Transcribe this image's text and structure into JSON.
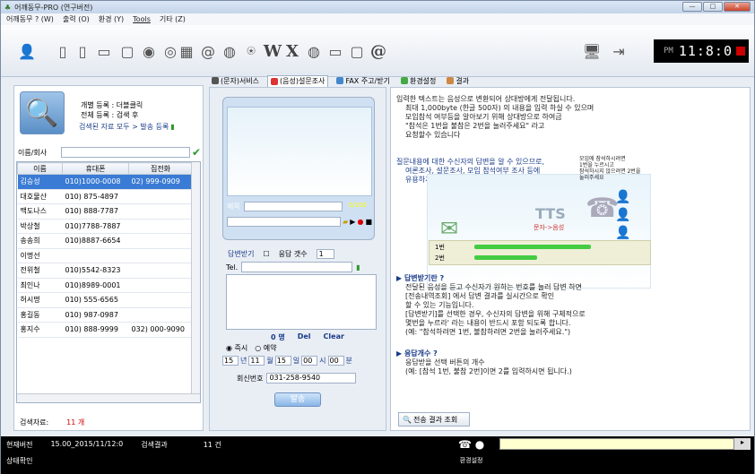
{
  "window": {
    "title": "어깨동무-PRO (연구버전)",
    "min": "—",
    "max": "□",
    "close": "✕"
  },
  "menu": [
    "어깨동무 ? (W)",
    "출력 (O)",
    "환경 (Y)",
    "Tools",
    "기타 (Z)"
  ],
  "toolbar": {
    "text_buttons": [
      "W",
      "X",
      "@"
    ],
    "clock_pm": "PM",
    "clock_time": "11:8:0"
  },
  "tabs": [
    "(문자)서비스",
    "(음성)설문조사",
    "FAX 주고/받기",
    "환경설정",
    "결과"
  ],
  "left": {
    "reg_personal": "개별 등록 : 더블클릭",
    "reg_all": "전체 등록 : 검색 후",
    "reg_link": "검색된 자료 모두 > 발송 등록",
    "search_label": "이름/회사",
    "columns": [
      "이름",
      "휴대폰",
      "집전화"
    ],
    "rows": [
      [
        "김승성",
        "010)1000-0008",
        "02) 999-0909"
      ],
      [
        "대호물산",
        "010) 875-4897",
        ""
      ],
      [
        "맥도나스",
        "010) 888-7787",
        ""
      ],
      [
        "박상철",
        "010)7788-7887",
        ""
      ],
      [
        "송송희",
        "010)8887-6654",
        ""
      ],
      [
        "이명선",
        "",
        ""
      ],
      [
        "전위철",
        "010)5542-8323",
        ""
      ],
      [
        "최인나",
        "010)8989-0001",
        ""
      ],
      [
        "허시명",
        "010) 555-6565",
        ""
      ],
      [
        "홍길동",
        "010) 987-0987",
        ""
      ],
      [
        "홍지수",
        "010) 888-9999",
        "032) 000-9090"
      ]
    ],
    "result_label": "검색자료:",
    "result_count": "11 개"
  },
  "mid": {
    "subject_label": "제목",
    "bytes": "0/100",
    "reply_label": "답변받기",
    "reply_count_label": "응답 갯수",
    "reply_count": "1",
    "tel_label": "Tel.",
    "count": "0 명",
    "del": "Del",
    "clear": "Clear",
    "radio_now": "즉시",
    "radio_reserve": "예약",
    "date_year": "15",
    "date_year_unit": "년",
    "date_month": "11",
    "date_month_unit": "월",
    "date_day": "15",
    "date_day_unit": "일",
    "date_hour": "00",
    "date_hour_unit": "시",
    "date_min": "00",
    "date_min_unit": "분",
    "callback_label": "회신번호",
    "callback_value": "031-258-9540",
    "send": "발송"
  },
  "right": {
    "p1": [
      "입력한 텍스트는 음성으로 변환되어 상대방에게 전달됩니다.",
      "최대 1,000byte (한글 500자) 의 내용을 입력 하실 수 있으며",
      "모임참석 여부등을 알아보기 위해 상대방으로 하여금",
      "\"참석은 1번을 불참은 2번을 눌러주세요\" 라고",
      "요청할수 있습니다"
    ],
    "p2": [
      "질문내용에 대한 수신자의 답변을 알 수 있으므로,",
      "여론조사, 설문조사, 모임 참석여부 조사 등에",
      "유용하게 쓰입니다"
    ],
    "illus_tts": "TTS",
    "illus_sub": "문자->음성",
    "bar1": "1번",
    "bar2": "2번",
    "side_note": [
      "모임에 참석하시려면",
      "1번을 누르시고",
      "참석하시지 않으려면 2번을",
      "눌러주세요"
    ],
    "h1": "답변받기란 ?",
    "h1_text": [
      "전달된 음성을 듣고 수신자가 원하는 번호를 눌러 답변 하면",
      "[전송내역조회] 에서 답변 결과를 실시간으로 확인",
      "할 수 있는 기능입니다.",
      "[답변받기]를 선택한 경우, 수신자의 답변을 위해 구체적으로",
      "몇번을 누르라' 라는 내용이 반드시 포함 되도록 합니다.",
      "(예: \"참석하려면 1번, 불참하려면 2번을 눌러주세요.\")"
    ],
    "h2": "응답개수 ?",
    "h2_text": [
      "응답받을 선택 버튼의 개수",
      "(예: [참석 1번, 불참 2번]이면  2를 입력하시면 됩니다.)"
    ],
    "result_button": "전송 결과 조회"
  },
  "status": {
    "version_label": "현재버전",
    "version": "15.00_2015/11/12:0",
    "result_label": "검색결과",
    "result": "11 건",
    "state": "상태확인",
    "settings": "환경설정",
    "go": "▸"
  }
}
